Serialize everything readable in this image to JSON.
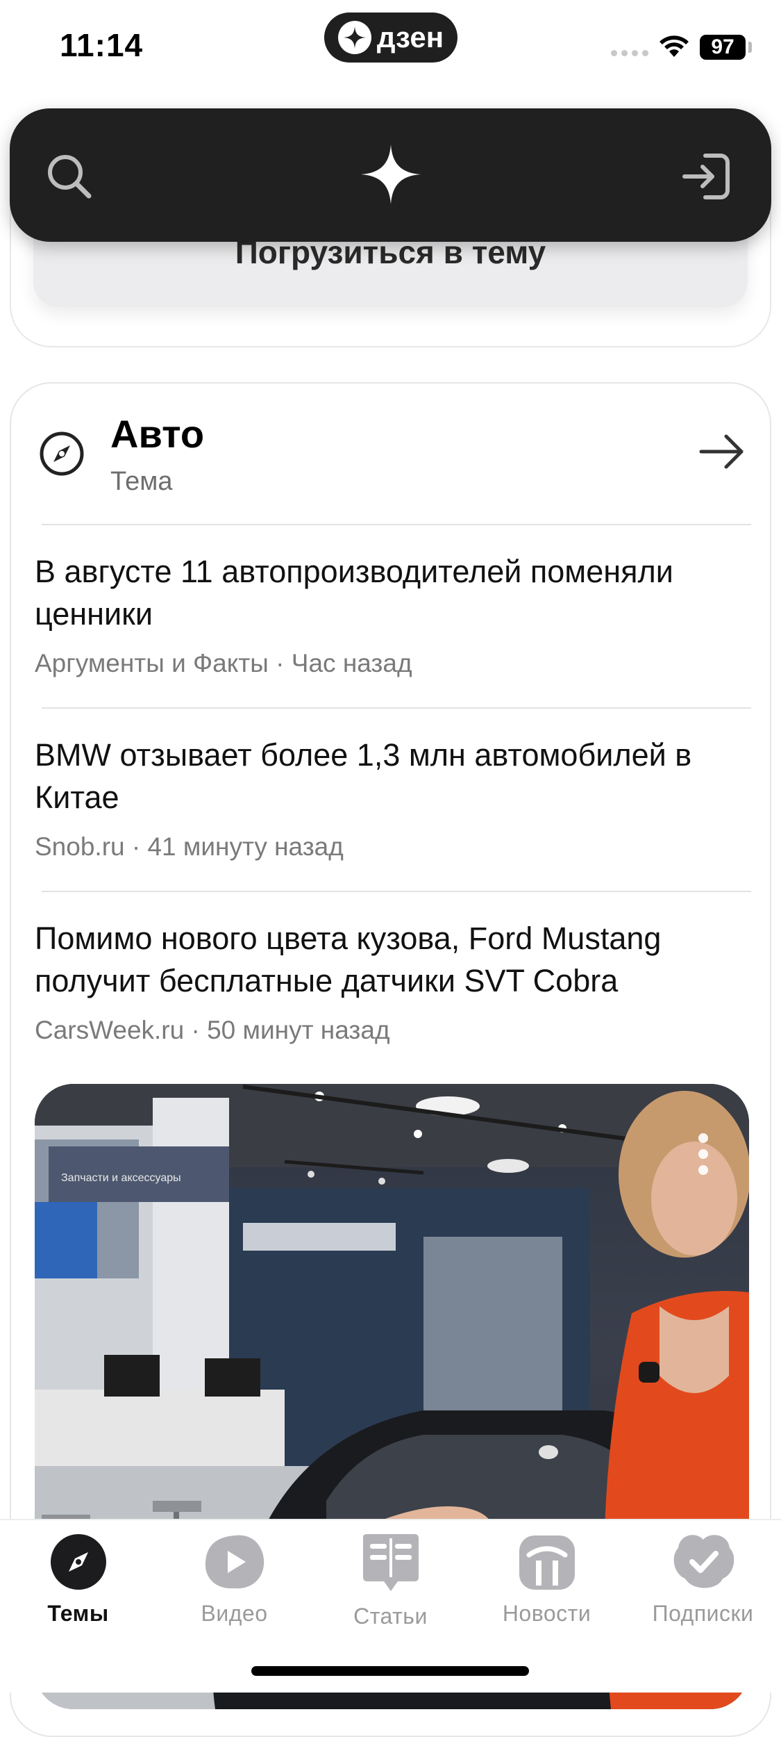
{
  "status_bar": {
    "time": "11:14",
    "app_pill": "дзен",
    "battery": "97"
  },
  "prev_card": {
    "button_label": "Погрузиться в тему"
  },
  "topic": {
    "title": "Авто",
    "subtitle": "Тема",
    "news": [
      {
        "title": "В августе 11 автопроизводителей поменяли ценники",
        "source": "Аргументы и Факты",
        "time": "Час назад"
      },
      {
        "title": "BMW отзывает более 1,3 млн автомобилей в Китае",
        "source": "Snob.ru",
        "time": "41 минуту назад"
      },
      {
        "title": "Помимо нового цвета кузова, Ford Mustang получит бесплатные датчики SVT Cobra",
        "source": "CarsWeek.ru",
        "time": "50 минут назад"
      }
    ],
    "video_sign": "Запчасти и аксессуары"
  },
  "tabs": [
    {
      "label": "Темы",
      "icon": "compass-icon",
      "active": true
    },
    {
      "label": "Видео",
      "icon": "play-icon",
      "active": false
    },
    {
      "label": "Статьи",
      "icon": "articles-icon",
      "active": false
    },
    {
      "label": "Новости",
      "icon": "news-icon",
      "active": false
    },
    {
      "label": "Подписки",
      "icon": "subscriptions-icon",
      "active": false
    }
  ],
  "colors": {
    "top_bar": "#202020",
    "active_tab": "#111111",
    "inactive_tab": "#9a9a9a"
  }
}
